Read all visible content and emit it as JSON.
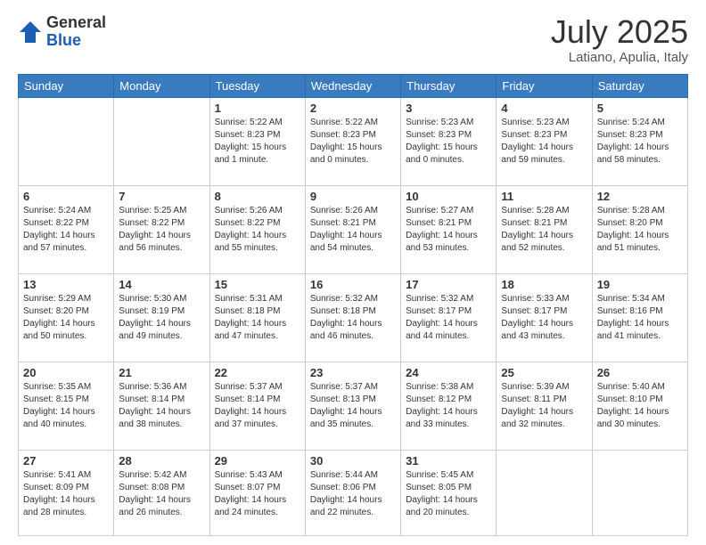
{
  "header": {
    "logo_general": "General",
    "logo_blue": "Blue",
    "month_title": "July 2025",
    "subtitle": "Latiano, Apulia, Italy"
  },
  "weekdays": [
    "Sunday",
    "Monday",
    "Tuesday",
    "Wednesday",
    "Thursday",
    "Friday",
    "Saturday"
  ],
  "weeks": [
    [
      {
        "day": "",
        "info": ""
      },
      {
        "day": "",
        "info": ""
      },
      {
        "day": "1",
        "info": "Sunrise: 5:22 AM\nSunset: 8:23 PM\nDaylight: 15 hours\nand 1 minute."
      },
      {
        "day": "2",
        "info": "Sunrise: 5:22 AM\nSunset: 8:23 PM\nDaylight: 15 hours\nand 0 minutes."
      },
      {
        "day": "3",
        "info": "Sunrise: 5:23 AM\nSunset: 8:23 PM\nDaylight: 15 hours\nand 0 minutes."
      },
      {
        "day": "4",
        "info": "Sunrise: 5:23 AM\nSunset: 8:23 PM\nDaylight: 14 hours\nand 59 minutes."
      },
      {
        "day": "5",
        "info": "Sunrise: 5:24 AM\nSunset: 8:23 PM\nDaylight: 14 hours\nand 58 minutes."
      }
    ],
    [
      {
        "day": "6",
        "info": "Sunrise: 5:24 AM\nSunset: 8:22 PM\nDaylight: 14 hours\nand 57 minutes."
      },
      {
        "day": "7",
        "info": "Sunrise: 5:25 AM\nSunset: 8:22 PM\nDaylight: 14 hours\nand 56 minutes."
      },
      {
        "day": "8",
        "info": "Sunrise: 5:26 AM\nSunset: 8:22 PM\nDaylight: 14 hours\nand 55 minutes."
      },
      {
        "day": "9",
        "info": "Sunrise: 5:26 AM\nSunset: 8:21 PM\nDaylight: 14 hours\nand 54 minutes."
      },
      {
        "day": "10",
        "info": "Sunrise: 5:27 AM\nSunset: 8:21 PM\nDaylight: 14 hours\nand 53 minutes."
      },
      {
        "day": "11",
        "info": "Sunrise: 5:28 AM\nSunset: 8:21 PM\nDaylight: 14 hours\nand 52 minutes."
      },
      {
        "day": "12",
        "info": "Sunrise: 5:28 AM\nSunset: 8:20 PM\nDaylight: 14 hours\nand 51 minutes."
      }
    ],
    [
      {
        "day": "13",
        "info": "Sunrise: 5:29 AM\nSunset: 8:20 PM\nDaylight: 14 hours\nand 50 minutes."
      },
      {
        "day": "14",
        "info": "Sunrise: 5:30 AM\nSunset: 8:19 PM\nDaylight: 14 hours\nand 49 minutes."
      },
      {
        "day": "15",
        "info": "Sunrise: 5:31 AM\nSunset: 8:18 PM\nDaylight: 14 hours\nand 47 minutes."
      },
      {
        "day": "16",
        "info": "Sunrise: 5:32 AM\nSunset: 8:18 PM\nDaylight: 14 hours\nand 46 minutes."
      },
      {
        "day": "17",
        "info": "Sunrise: 5:32 AM\nSunset: 8:17 PM\nDaylight: 14 hours\nand 44 minutes."
      },
      {
        "day": "18",
        "info": "Sunrise: 5:33 AM\nSunset: 8:17 PM\nDaylight: 14 hours\nand 43 minutes."
      },
      {
        "day": "19",
        "info": "Sunrise: 5:34 AM\nSunset: 8:16 PM\nDaylight: 14 hours\nand 41 minutes."
      }
    ],
    [
      {
        "day": "20",
        "info": "Sunrise: 5:35 AM\nSunset: 8:15 PM\nDaylight: 14 hours\nand 40 minutes."
      },
      {
        "day": "21",
        "info": "Sunrise: 5:36 AM\nSunset: 8:14 PM\nDaylight: 14 hours\nand 38 minutes."
      },
      {
        "day": "22",
        "info": "Sunrise: 5:37 AM\nSunset: 8:14 PM\nDaylight: 14 hours\nand 37 minutes."
      },
      {
        "day": "23",
        "info": "Sunrise: 5:37 AM\nSunset: 8:13 PM\nDaylight: 14 hours\nand 35 minutes."
      },
      {
        "day": "24",
        "info": "Sunrise: 5:38 AM\nSunset: 8:12 PM\nDaylight: 14 hours\nand 33 minutes."
      },
      {
        "day": "25",
        "info": "Sunrise: 5:39 AM\nSunset: 8:11 PM\nDaylight: 14 hours\nand 32 minutes."
      },
      {
        "day": "26",
        "info": "Sunrise: 5:40 AM\nSunset: 8:10 PM\nDaylight: 14 hours\nand 30 minutes."
      }
    ],
    [
      {
        "day": "27",
        "info": "Sunrise: 5:41 AM\nSunset: 8:09 PM\nDaylight: 14 hours\nand 28 minutes."
      },
      {
        "day": "28",
        "info": "Sunrise: 5:42 AM\nSunset: 8:08 PM\nDaylight: 14 hours\nand 26 minutes."
      },
      {
        "day": "29",
        "info": "Sunrise: 5:43 AM\nSunset: 8:07 PM\nDaylight: 14 hours\nand 24 minutes."
      },
      {
        "day": "30",
        "info": "Sunrise: 5:44 AM\nSunset: 8:06 PM\nDaylight: 14 hours\nand 22 minutes."
      },
      {
        "day": "31",
        "info": "Sunrise: 5:45 AM\nSunset: 8:05 PM\nDaylight: 14 hours\nand 20 minutes."
      },
      {
        "day": "",
        "info": ""
      },
      {
        "day": "",
        "info": ""
      }
    ]
  ]
}
